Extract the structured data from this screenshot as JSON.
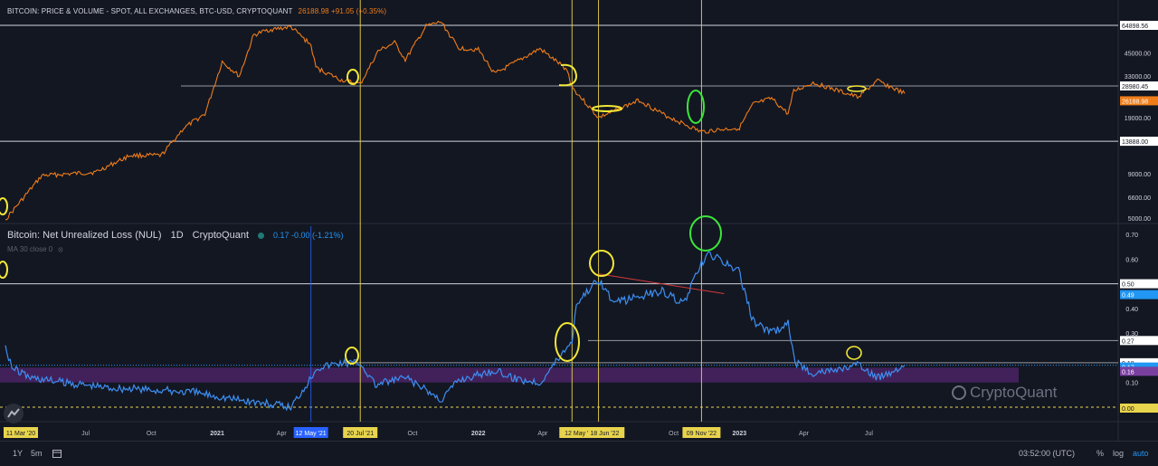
{
  "header": {
    "price_title": "BITCOIN: PRICE & VOLUME - SPOT, ALL EXCHANGES, BTC-USD, CRYPTOQUANT",
    "price_value": "26188.98 +91.05 (+0.35%)",
    "nul_title": "Bitcoin: Net Unrealized Loss (NUL)",
    "nul_interval": "1D",
    "nul_source": "CryptoQuant",
    "nul_values": "0.17  -0.00 (-1.21%)",
    "ma_label": "MA 30 close 0"
  },
  "watermark": "CryptoQuant",
  "colors": {
    "background": "#131722",
    "price_line": "#f07d1a",
    "nul_line": "#3d8ff2",
    "annotation_yellow": "#f2e836",
    "annotation_green": "#3be63b",
    "vline_yellow": "#e8d44d",
    "vline_blue": "#2962ff",
    "band_purple": "#6a2a8a",
    "trend_red": "#d23a3a"
  },
  "bottombar": {
    "range": "1Y",
    "interval": "5m",
    "calendar_icon": "calendar-icon",
    "time": "03:52:00 (UTC)",
    "percent": "%",
    "log": "log",
    "auto": "auto"
  },
  "chart_data": [
    {
      "type": "line",
      "series": [
        {
          "name": "BITCOIN: PRICE & VOLUME - SPOT, ALL EXCHANGES, BTC-USD, CRYPTOQUANT",
          "color": "#f07d1a"
        }
      ],
      "x": [
        "2020-03-11",
        "2020-05-01",
        "2020-07-15",
        "2020-09-01",
        "2020-10-15",
        "2020-11-15",
        "2020-12-15",
        "2021-01-08",
        "2021-02-01",
        "2021-02-21",
        "2021-03-13",
        "2021-04-14",
        "2021-05-12",
        "2021-05-19",
        "2021-06-22",
        "2021-07-20",
        "2021-08-14",
        "2021-09-06",
        "2021-09-21",
        "2021-10-20",
        "2021-11-10",
        "2021-12-04",
        "2022-01-01",
        "2022-01-24",
        "2022-03-28",
        "2022-05-05",
        "2022-05-12",
        "2022-06-18",
        "2022-08-14",
        "2022-09-15",
        "2022-11-09",
        "2022-11-21",
        "2023-01-01",
        "2023-01-20",
        "2023-02-15",
        "2023-03-10",
        "2023-03-18",
        "2023-04-14",
        "2023-06-15",
        "2023-07-13",
        "2023-08-20"
      ],
      "y": [
        4900,
        8800,
        9200,
        11500,
        11500,
        16500,
        20000,
        40000,
        33000,
        57000,
        61000,
        63500,
        50000,
        37000,
        31500,
        29700,
        46000,
        51500,
        41000,
        64000,
        68000,
        48000,
        47000,
        34000,
        47500,
        36000,
        28500,
        19000,
        24000,
        20000,
        15700,
        16000,
        16600,
        22700,
        24500,
        20000,
        27000,
        30300,
        25000,
        31000,
        26188.98
      ],
      "y_log_scale": true,
      "y_ticks": [
        5000,
        6600,
        9000,
        13888,
        19000,
        28980.45,
        33000,
        45000,
        64898.56
      ],
      "y_tick_labels": [
        "5000.00",
        "6600.00",
        "9000.00",
        "13888.00",
        "19000.00",
        "28980.45",
        "33000.00",
        "45000.00",
        "64898.56"
      ],
      "last_value_label": "26188.98",
      "horizontal_levels": [
        64898.56,
        28980.45,
        13888
      ]
    },
    {
      "type": "line",
      "series": [
        {
          "name": "Bitcoin: Net Unrealized Loss (NUL)",
          "color": "#3d8ff2"
        }
      ],
      "x": [
        "2020-03-11",
        "2020-03-20",
        "2020-04-15",
        "2020-06-01",
        "2020-08-01",
        "2020-10-01",
        "2020-12-01",
        "2021-02-01",
        "2021-04-14",
        "2021-05-12",
        "2021-05-19",
        "2021-06-22",
        "2021-07-20",
        "2021-08-10",
        "2021-09-21",
        "2021-11-10",
        "2021-12-04",
        "2022-01-24",
        "2022-02-15",
        "2022-03-28",
        "2022-05-12",
        "2022-05-18",
        "2022-06-18",
        "2022-07-10",
        "2022-08-14",
        "2022-09-15",
        "2022-10-15",
        "2022-11-09",
        "2022-11-21",
        "2022-12-31",
        "2023-01-20",
        "2023-02-15",
        "2023-03-10",
        "2023-03-20",
        "2023-04-14",
        "2023-05-15",
        "2023-06-15",
        "2023-07-13",
        "2023-08-20"
      ],
      "y": [
        0.25,
        0.16,
        0.12,
        0.1,
        0.08,
        0.07,
        0.06,
        0.03,
        0.0,
        0.12,
        0.16,
        0.18,
        0.18,
        0.09,
        0.12,
        0.03,
        0.11,
        0.15,
        0.12,
        0.1,
        0.27,
        0.42,
        0.52,
        0.42,
        0.45,
        0.47,
        0.42,
        0.58,
        0.62,
        0.55,
        0.35,
        0.3,
        0.34,
        0.18,
        0.14,
        0.15,
        0.17,
        0.12,
        0.17
      ],
      "y_ticks": [
        0.0,
        0.1,
        0.16,
        0.17,
        0.18,
        0.27,
        0.3,
        0.4,
        0.49,
        0.5,
        0.6,
        0.7
      ],
      "y_tick_labels": [
        "0.00",
        "0.10",
        "0.16",
        "0.17",
        "0.18",
        "0.27",
        "0.30",
        "0.40",
        "0.49",
        "0.50",
        "0.60",
        "0.70"
      ],
      "horizontal_levels": [
        0.5,
        0.27,
        0.18,
        0.0
      ],
      "band": [
        0.1,
        0.16
      ]
    }
  ],
  "x_axis": {
    "tick_labels": [
      "Jul",
      "Oct",
      "2021",
      "Apr",
      "Jul",
      "Oct",
      "2022",
      "Apr",
      "Jul",
      "Oct",
      "2023",
      "Apr",
      "Jul"
    ],
    "highlighted_dates": [
      "11 Mar '20",
      "12 May '21",
      "20 Jul '21",
      "12 May ' 18 Jun '22",
      "09 Nov '22"
    ]
  },
  "vertical_markers": [
    {
      "date": "2021-05-12",
      "color": "blue"
    },
    {
      "date": "2021-07-20",
      "color": "yellow"
    },
    {
      "date": "2022-05-12",
      "color": "yellow"
    },
    {
      "date": "2022-06-18",
      "color": "yellow"
    },
    {
      "date": "2022-11-09",
      "color": "yellow"
    }
  ]
}
